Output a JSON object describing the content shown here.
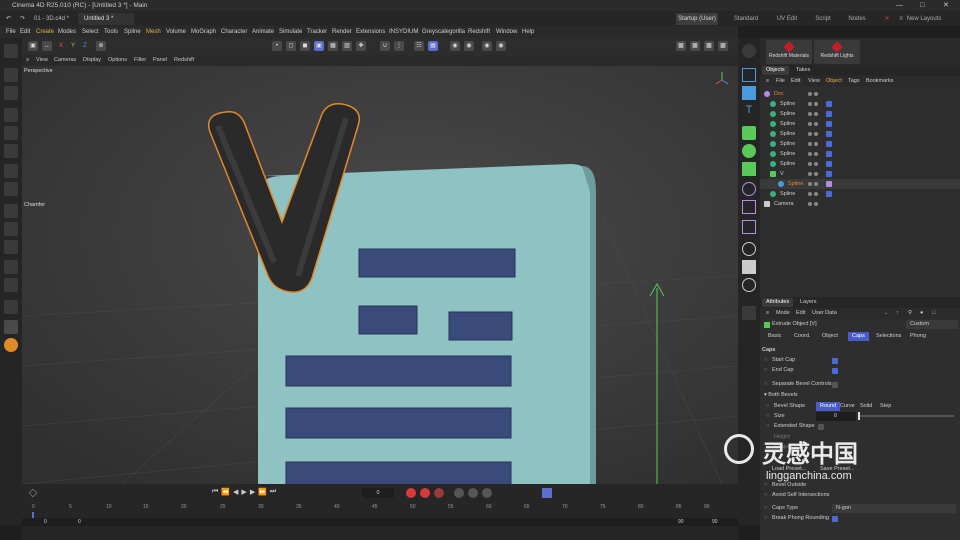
{
  "window": {
    "title": "Cinema 4D R25.010 (RC) - [Untitled 3 *] - Main"
  },
  "doc_tabs": [
    {
      "label": "01 - 3D.c4d *"
    },
    {
      "label": "Untitled 3 *"
    }
  ],
  "layouts": [
    "Startup (User)",
    "Standard",
    "UV Edit",
    "Script",
    "Nodes"
  ],
  "new_layouts": "New Layouts",
  "menu": [
    "File",
    "Edit",
    "Create",
    "Modes",
    "Select",
    "Tools",
    "Spline",
    "Mesh",
    "Volume",
    "MoGraph",
    "Character",
    "Animate",
    "Simulate",
    "Tracker",
    "Render",
    "Extensions",
    "INSYDIUM",
    "Greyscalegorilla",
    "Redshift",
    "Window",
    "Help"
  ],
  "axis_labels": [
    "X",
    "Y",
    "Z"
  ],
  "viewport": {
    "menu": [
      "View",
      "Cameras",
      "Display",
      "Options",
      "Filter",
      "Panel",
      "Redshift"
    ],
    "camera_label": "Perspective",
    "hud_label": "Chamfer",
    "letter": "V"
  },
  "redshift": {
    "materials": "Redshift Materials",
    "lights": "Redshift Lights"
  },
  "objects_panel": {
    "tabs": [
      "Objects",
      "Takes"
    ],
    "menu": [
      "File",
      "Edit",
      "View",
      "Object",
      "Tags",
      "Bookmarks"
    ],
    "items": [
      {
        "name": "Doc",
        "color": "#e8873a"
      },
      {
        "name": "Spline"
      },
      {
        "name": "Spline"
      },
      {
        "name": "Spline"
      },
      {
        "name": "Spline"
      },
      {
        "name": "Spline"
      },
      {
        "name": "Spline"
      },
      {
        "name": "Spline"
      },
      {
        "name": "V"
      },
      {
        "name": "Spline",
        "color": "#e8873a"
      },
      {
        "name": "Spline"
      },
      {
        "name": "Camera"
      }
    ]
  },
  "attributes_panel": {
    "tabs": [
      "Attributes",
      "Layers"
    ],
    "menu": [
      "Mode",
      "Edit",
      "User Data"
    ],
    "object_name": "Extrude Object [V]",
    "preset": "Custom",
    "subtabs": [
      "Basic",
      "Coord.",
      "Object",
      "Caps",
      "Selections",
      "Phong"
    ],
    "active_subtab": "Caps",
    "section": "Caps",
    "start_cap": "Start Cap",
    "end_cap": "End Cap",
    "separate_bevel": "Separate Bevel Controls",
    "both_bevels": "Both Bevels",
    "bevel_shape": "Bevel Shape",
    "bevel_options": [
      "Round",
      "Curve",
      "Solid",
      "Step"
    ],
    "size_label": "Size",
    "size_value": "0",
    "extended_shape": "Extended Shape",
    "height": "Height",
    "shape_depth": "Shape Depth",
    "load_preset": "Load Preset...",
    "save_preset": "Save Preset...",
    "bevel_outside": "Bevel Outside",
    "avoid_self": "Avoid Self Intersections",
    "caps_type_label": "Caps Type",
    "caps_type_value": "N-gon",
    "break_phong": "Break Phong Rounding"
  },
  "timeline": {
    "ticks": [
      "0",
      "5",
      "10",
      "15",
      "20",
      "25",
      "30",
      "35",
      "40",
      "45",
      "50",
      "55",
      "60",
      "65",
      "70",
      "75",
      "80",
      "85",
      "90"
    ],
    "current_frame": "0",
    "start": "0",
    "start2": "0",
    "end": "90",
    "end2": "90"
  },
  "watermark": {
    "cn": "灵感中国",
    "url": "lingganchina.com"
  }
}
